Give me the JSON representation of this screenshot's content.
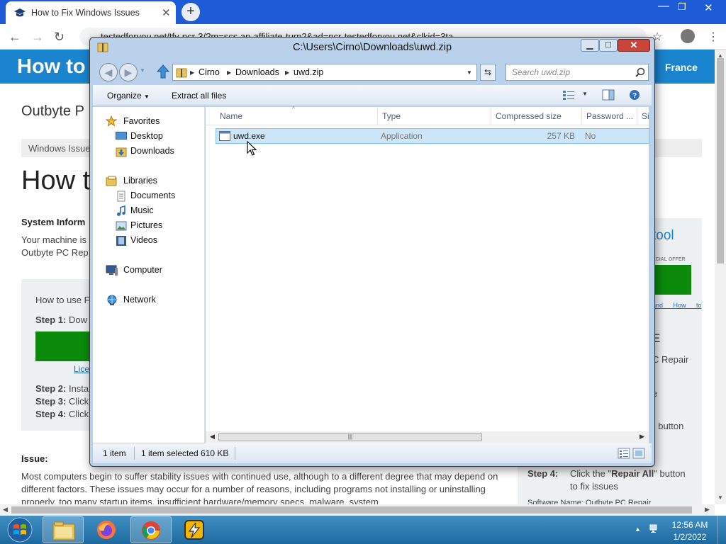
{
  "browser": {
    "tab_title": "How to Fix Windows Issues",
    "url": "testedforyou.net/tfy-ncr-3/?m=scs.ap-affiliate-turn2&ad=ncr-testedforyou.net&clkid=3ta..."
  },
  "site": {
    "logo_text": "How to",
    "lang": "France",
    "title_fragment": "Outbyte P",
    "breadcrumb_fragment": "Windows Issue",
    "h1_fragment": "How t",
    "system_info_label": "System Inform",
    "machine_line1": "Your machine is",
    "machine_line2": "Outbyte PC Rep",
    "howto_label": "How to use F",
    "step1_label": "Step 1:",
    "step1_text": "Dow",
    "license_link": "Lice",
    "step2_label": "Step 2:",
    "step2_text": "Insta",
    "step3_label": "Step 3:",
    "step3_text": "Click",
    "step4_label": "Step 4:",
    "step4_text": "Click",
    "issue_label": "Issue:",
    "issue_text": "Most computers begin to suffer stability issues with continued use, although to a different degree that may depend on different factors. These issues may occur for a number of reasons, including programs not installing or uninstalling properly, too many startup items, insufficient hardware/memory specs, malware, system",
    "right_tool": "tool",
    "right_offer": "ECIAL OFFER",
    "right_links": "and How to",
    "right_E": "E",
    "right_pcrepair": "C Repair",
    "right_e2": "e",
    "right_button1": "\" button",
    "right_step4_label": "Step 4:",
    "right_step4_text_a": "Click the \"",
    "right_step4_bold": "Repair All",
    "right_step4_text_b": "\" button",
    "right_step4_text_c": "to fix issues",
    "right_software": "Software Name:     Outbyte PC Repair"
  },
  "explorer": {
    "title": "C:\\Users\\Cirno\\Downloads\\uwd.zip",
    "breadcrumb": [
      "Cirno",
      "Downloads",
      "uwd.zip"
    ],
    "search_placeholder": "Search uwd.zip",
    "organize_label": "Organize",
    "extract_label": "Extract all files",
    "nav": {
      "favorites": "Favorites",
      "desktop": "Desktop",
      "downloads": "Downloads",
      "libraries": "Libraries",
      "documents": "Documents",
      "music": "Music",
      "pictures": "Pictures",
      "videos": "Videos",
      "computer": "Computer",
      "network": "Network"
    },
    "columns": {
      "name": "Name",
      "type": "Type",
      "compressed": "Compressed size",
      "password": "Password ...",
      "size": "Si"
    },
    "files": [
      {
        "name": "uwd.exe",
        "type": "Application",
        "compressed_size": "257 KB",
        "password": "No"
      }
    ],
    "status": {
      "count": "1 item",
      "selected": "1 item selected  610 KB"
    }
  },
  "taskbar": {
    "time": "12:56 AM",
    "date": "1/2/2022"
  },
  "colors": {
    "chrome_tabbar": "#1e5bd6",
    "site_header": "#1a84cf",
    "green_button": "#0c8a0c",
    "row_selected": "#cde6f7",
    "taskbar": "#2c7ab0"
  }
}
